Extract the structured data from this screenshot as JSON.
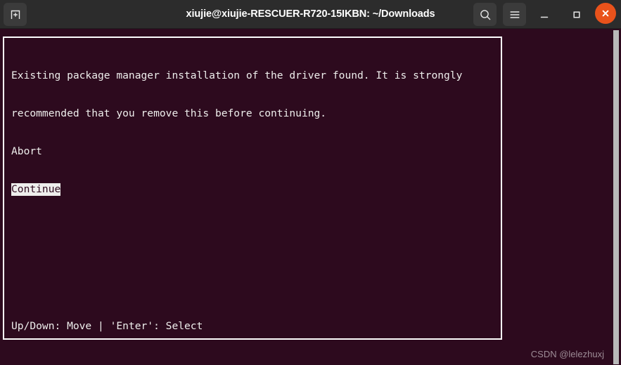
{
  "window": {
    "title": "xiujie@xiujie-RESCUER-R720-15IKBN: ~/Downloads",
    "new_tab_icon": "new-tab-icon",
    "search_icon": "search-icon",
    "menu_icon": "hamburger-menu-icon",
    "minimize_icon": "minimize-icon",
    "maximize_icon": "maximize-icon",
    "close_icon": "close-icon",
    "titlebar_color": "#2c2c2c",
    "close_button_color": "#e9521b"
  },
  "terminal": {
    "background_color": "#2d0a1e",
    "foreground_color": "#eeeeec",
    "dialog": {
      "border_color": "#ffffff",
      "message_line_1": "Existing package manager installation of the driver found. It is strongly",
      "message_line_2": "recommended that you remove this before continuing.",
      "options": [
        {
          "label": "Abort",
          "selected": false
        },
        {
          "label": "Continue",
          "selected": true
        }
      ],
      "hint": "Up/Down: Move | 'Enter': Select",
      "selection_bg": "#eeeeec",
      "selection_fg": "#2d0a1e"
    }
  },
  "scrollbar": {
    "thumb_color": "#b9b9b9"
  },
  "watermark": {
    "text": "CSDN @lelezhuxj"
  }
}
